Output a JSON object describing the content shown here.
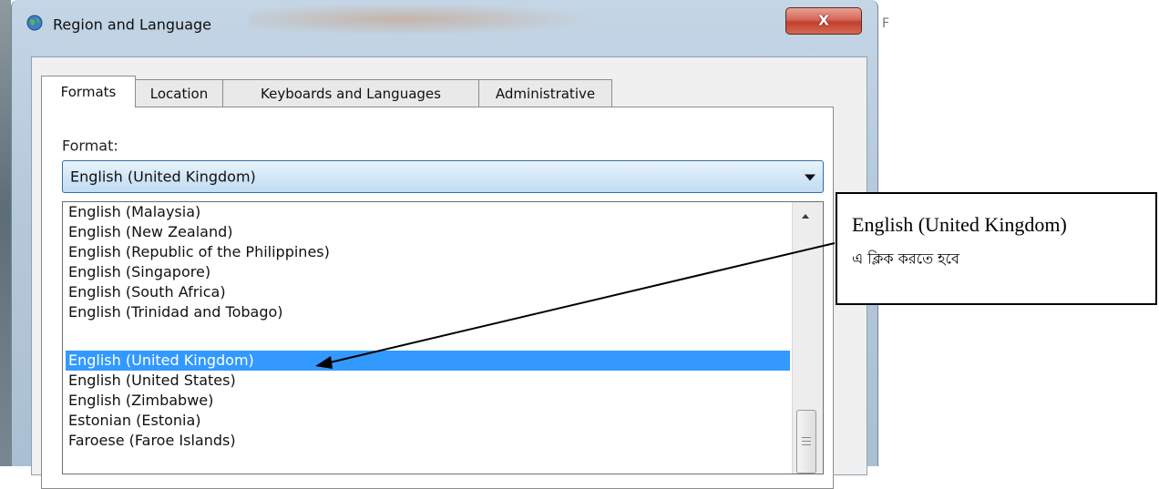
{
  "window": {
    "title": "Region and Language",
    "close_label": "X"
  },
  "tabs": [
    {
      "label": "Formats",
      "active": true
    },
    {
      "label": "Location",
      "active": false
    },
    {
      "label": "Keyboards and Languages",
      "active": false
    },
    {
      "label": "Administrative",
      "active": false
    }
  ],
  "format": {
    "label": "Format:",
    "selected": "English (United Kingdom)",
    "options": [
      "English (Malaysia)",
      "English (New Zealand)",
      "English (Republic of the Philippines)",
      "English (Singapore)",
      "English (South Africa)",
      "English (Trinidad and Tobago)",
      "English (United Kingdom)",
      "English (United States)",
      "English (Zimbabwe)",
      "Estonian (Estonia)",
      "Faroese (Faroe Islands)"
    ],
    "highlighted_index": 6
  },
  "annotation": {
    "line1": "English (United Kingdom)",
    "line2": "এ ক্লিক করতে হবে"
  },
  "sliver": "F",
  "colors": {
    "selection": "#3399ff",
    "arrow": "#000000"
  }
}
